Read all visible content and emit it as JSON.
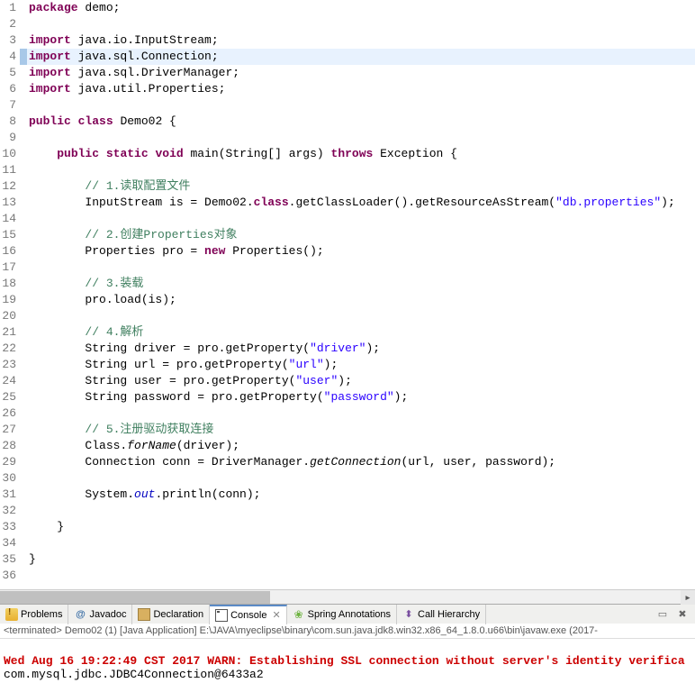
{
  "code": {
    "lines": [
      {
        "n": 1,
        "segs": [
          [
            "kw",
            "package"
          ],
          [
            "",
            " demo;"
          ]
        ]
      },
      {
        "n": 2,
        "segs": []
      },
      {
        "n": 3,
        "segs": [
          [
            "kw",
            "import"
          ],
          [
            "",
            " java.io.InputStream;"
          ]
        ]
      },
      {
        "n": 4,
        "hl": true,
        "segs": [
          [
            "kw",
            "import"
          ],
          [
            "",
            " java.sql.Connection;"
          ]
        ]
      },
      {
        "n": 5,
        "segs": [
          [
            "kw",
            "import"
          ],
          [
            "",
            " java.sql.DriverManager;"
          ]
        ]
      },
      {
        "n": 6,
        "segs": [
          [
            "kw",
            "import"
          ],
          [
            "",
            " java.util.Properties;"
          ]
        ]
      },
      {
        "n": 7,
        "segs": []
      },
      {
        "n": 8,
        "segs": [
          [
            "kw",
            "public"
          ],
          [
            "",
            " "
          ],
          [
            "kw",
            "class"
          ],
          [
            "",
            " Demo02 {"
          ]
        ]
      },
      {
        "n": 9,
        "segs": []
      },
      {
        "n": 10,
        "segs": [
          [
            "",
            "    "
          ],
          [
            "kw",
            "public"
          ],
          [
            "",
            " "
          ],
          [
            "kw",
            "static"
          ],
          [
            "",
            " "
          ],
          [
            "kw",
            "void"
          ],
          [
            "",
            " main(String[] args) "
          ],
          [
            "kw",
            "throws"
          ],
          [
            "",
            " Exception {"
          ]
        ]
      },
      {
        "n": 11,
        "segs": []
      },
      {
        "n": 12,
        "segs": [
          [
            "",
            "        "
          ],
          [
            "cmt",
            "// 1.读取配置文件"
          ]
        ]
      },
      {
        "n": 13,
        "segs": [
          [
            "",
            "        InputStream is = Demo02."
          ],
          [
            "kw",
            "class"
          ],
          [
            "",
            ".getClassLoader().getResourceAsStream("
          ],
          [
            "str",
            "\"db.properties\""
          ],
          [
            "",
            ");"
          ]
        ]
      },
      {
        "n": 14,
        "segs": []
      },
      {
        "n": 15,
        "segs": [
          [
            "",
            "        "
          ],
          [
            "cmt",
            "// 2.创建Properties对象"
          ]
        ]
      },
      {
        "n": 16,
        "segs": [
          [
            "",
            "        Properties pro = "
          ],
          [
            "kw",
            "new"
          ],
          [
            "",
            " Properties();"
          ]
        ]
      },
      {
        "n": 17,
        "segs": []
      },
      {
        "n": 18,
        "segs": [
          [
            "",
            "        "
          ],
          [
            "cmt",
            "// 3.装载"
          ]
        ]
      },
      {
        "n": 19,
        "segs": [
          [
            "",
            "        pro.load(is);"
          ]
        ]
      },
      {
        "n": 20,
        "segs": []
      },
      {
        "n": 21,
        "segs": [
          [
            "",
            "        "
          ],
          [
            "cmt",
            "// 4.解析"
          ]
        ]
      },
      {
        "n": 22,
        "segs": [
          [
            "",
            "        String driver = pro.getProperty("
          ],
          [
            "str",
            "\"driver\""
          ],
          [
            "",
            ");"
          ]
        ]
      },
      {
        "n": 23,
        "segs": [
          [
            "",
            "        String url = pro.getProperty("
          ],
          [
            "str",
            "\"url\""
          ],
          [
            "",
            ");"
          ]
        ]
      },
      {
        "n": 24,
        "segs": [
          [
            "",
            "        String user = pro.getProperty("
          ],
          [
            "str",
            "\"user\""
          ],
          [
            "",
            ");"
          ]
        ]
      },
      {
        "n": 25,
        "segs": [
          [
            "",
            "        String password = pro.getProperty("
          ],
          [
            "str",
            "\"password\""
          ],
          [
            "",
            ");"
          ]
        ]
      },
      {
        "n": 26,
        "segs": []
      },
      {
        "n": 27,
        "segs": [
          [
            "",
            "        "
          ],
          [
            "cmt",
            "// 5.注册驱动获取连接"
          ]
        ]
      },
      {
        "n": 28,
        "segs": [
          [
            "",
            "        Class."
          ],
          [
            "mtd",
            "forName"
          ],
          [
            "",
            "(driver);"
          ]
        ]
      },
      {
        "n": 29,
        "segs": [
          [
            "",
            "        Connection conn = DriverManager."
          ],
          [
            "mtd",
            "getConnection"
          ],
          [
            "",
            "(url, user, password);"
          ]
        ]
      },
      {
        "n": 30,
        "segs": []
      },
      {
        "n": 31,
        "segs": [
          [
            "",
            "        System."
          ],
          [
            "fld",
            "out"
          ],
          [
            "",
            ".println(conn);"
          ]
        ]
      },
      {
        "n": 32,
        "segs": []
      },
      {
        "n": 33,
        "segs": [
          [
            "",
            "    }"
          ]
        ]
      },
      {
        "n": 34,
        "segs": []
      },
      {
        "n": 35,
        "segs": [
          [
            "",
            "}"
          ]
        ]
      },
      {
        "n": 36,
        "segs": []
      }
    ]
  },
  "tabs": {
    "problems": "Problems",
    "javadoc": "Javadoc",
    "declaration": "Declaration",
    "console": "Console",
    "spring": "Spring Annotations",
    "callh": "Call Hierarchy"
  },
  "console": {
    "header": "<terminated> Demo02 (1) [Java Application] E:\\JAVA\\myeclipse\\binary\\com.sun.java.jdk8.win32.x86_64_1.8.0.u66\\bin\\javaw.exe (2017-",
    "err": "Wed Aug 16 19:22:49 CST 2017 WARN: Establishing SSL connection without server's identity verifica",
    "out": "com.mysql.jdbc.JDBC4Connection@6433a2"
  }
}
